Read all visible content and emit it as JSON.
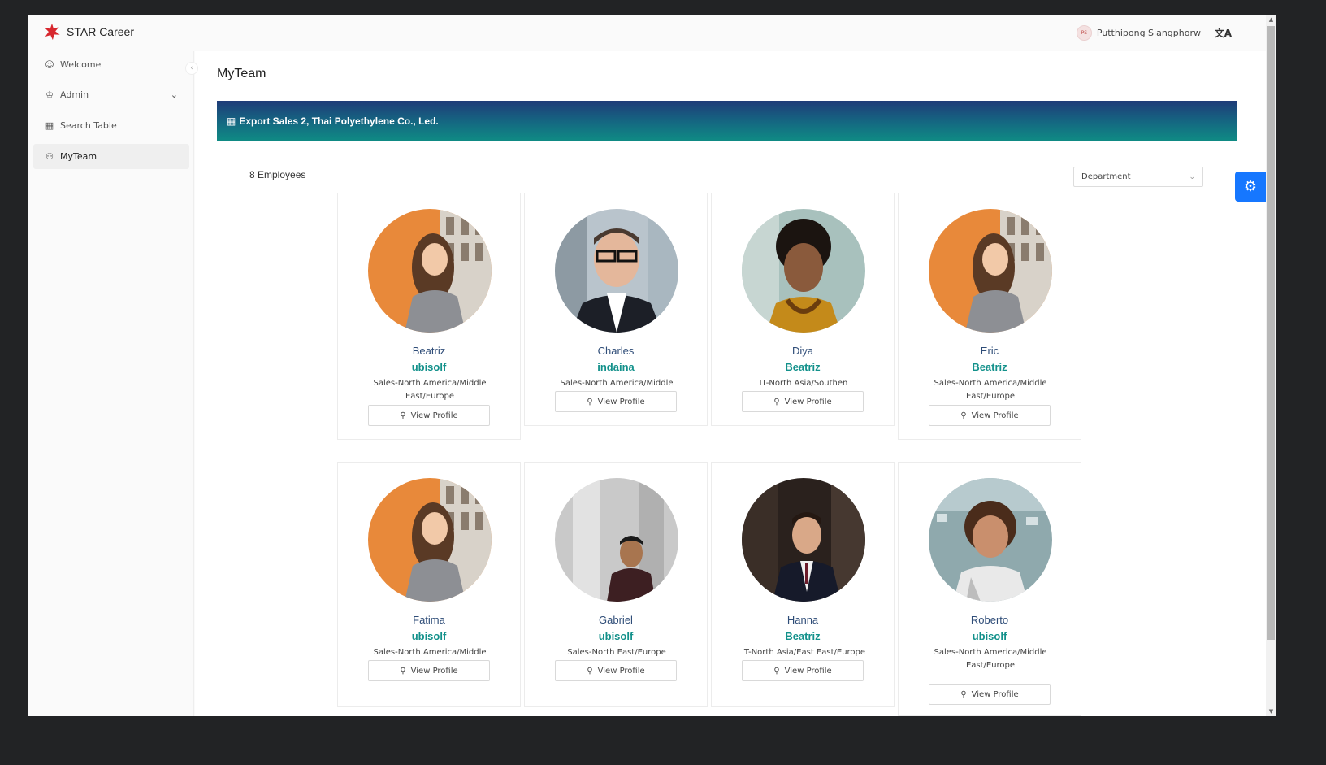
{
  "app": {
    "name": "STAR Career"
  },
  "header": {
    "user_initials": "PS",
    "user_name": "Putthipong Siangphorw",
    "lang_icon": "translate-icon"
  },
  "sidebar": {
    "items": [
      {
        "label": "Welcome",
        "icon": "smile-icon"
      },
      {
        "label": "Admin",
        "icon": "crown-icon"
      },
      {
        "label": "Search Table",
        "icon": "table-icon"
      },
      {
        "label": "MyTeam",
        "icon": "team-icon"
      }
    ]
  },
  "main": {
    "title": "MyTeam",
    "banner": "Export Sales 2, Thai Polyethylene Co., Led.",
    "employee_count": "8 Employees",
    "filter_placeholder": "Department",
    "view_profile_label": "View Profile"
  },
  "employees": [
    {
      "name": "Beatriz",
      "company": "ubisolf",
      "department": "Sales-North America/Middle East/Europe"
    },
    {
      "name": "Charles",
      "company": "indaina",
      "department": "Sales-North America/Middle"
    },
    {
      "name": "Diya",
      "company": "Beatriz",
      "department": "IT-North Asia/Southen"
    },
    {
      "name": "Eric",
      "company": "Beatriz",
      "department": "Sales-North America/Middle East/Europe"
    },
    {
      "name": "Fatima",
      "company": "ubisolf",
      "department": "Sales-North America/Middle"
    },
    {
      "name": "Gabriel",
      "company": "ubisolf",
      "department": "Sales-North East/Europe"
    },
    {
      "name": "Hanna",
      "company": "Beatriz",
      "department": "IT-North Asia/East East/Europe"
    },
    {
      "name": "Roberto",
      "company": "ubisolf",
      "department": "Sales-North America/Middle East/Europe"
    }
  ],
  "colors": {
    "accent": "#1677ff",
    "name": "#2f4d78",
    "company": "#13918b",
    "banner_start": "#1f3b78",
    "banner_end": "#0f8c84"
  }
}
